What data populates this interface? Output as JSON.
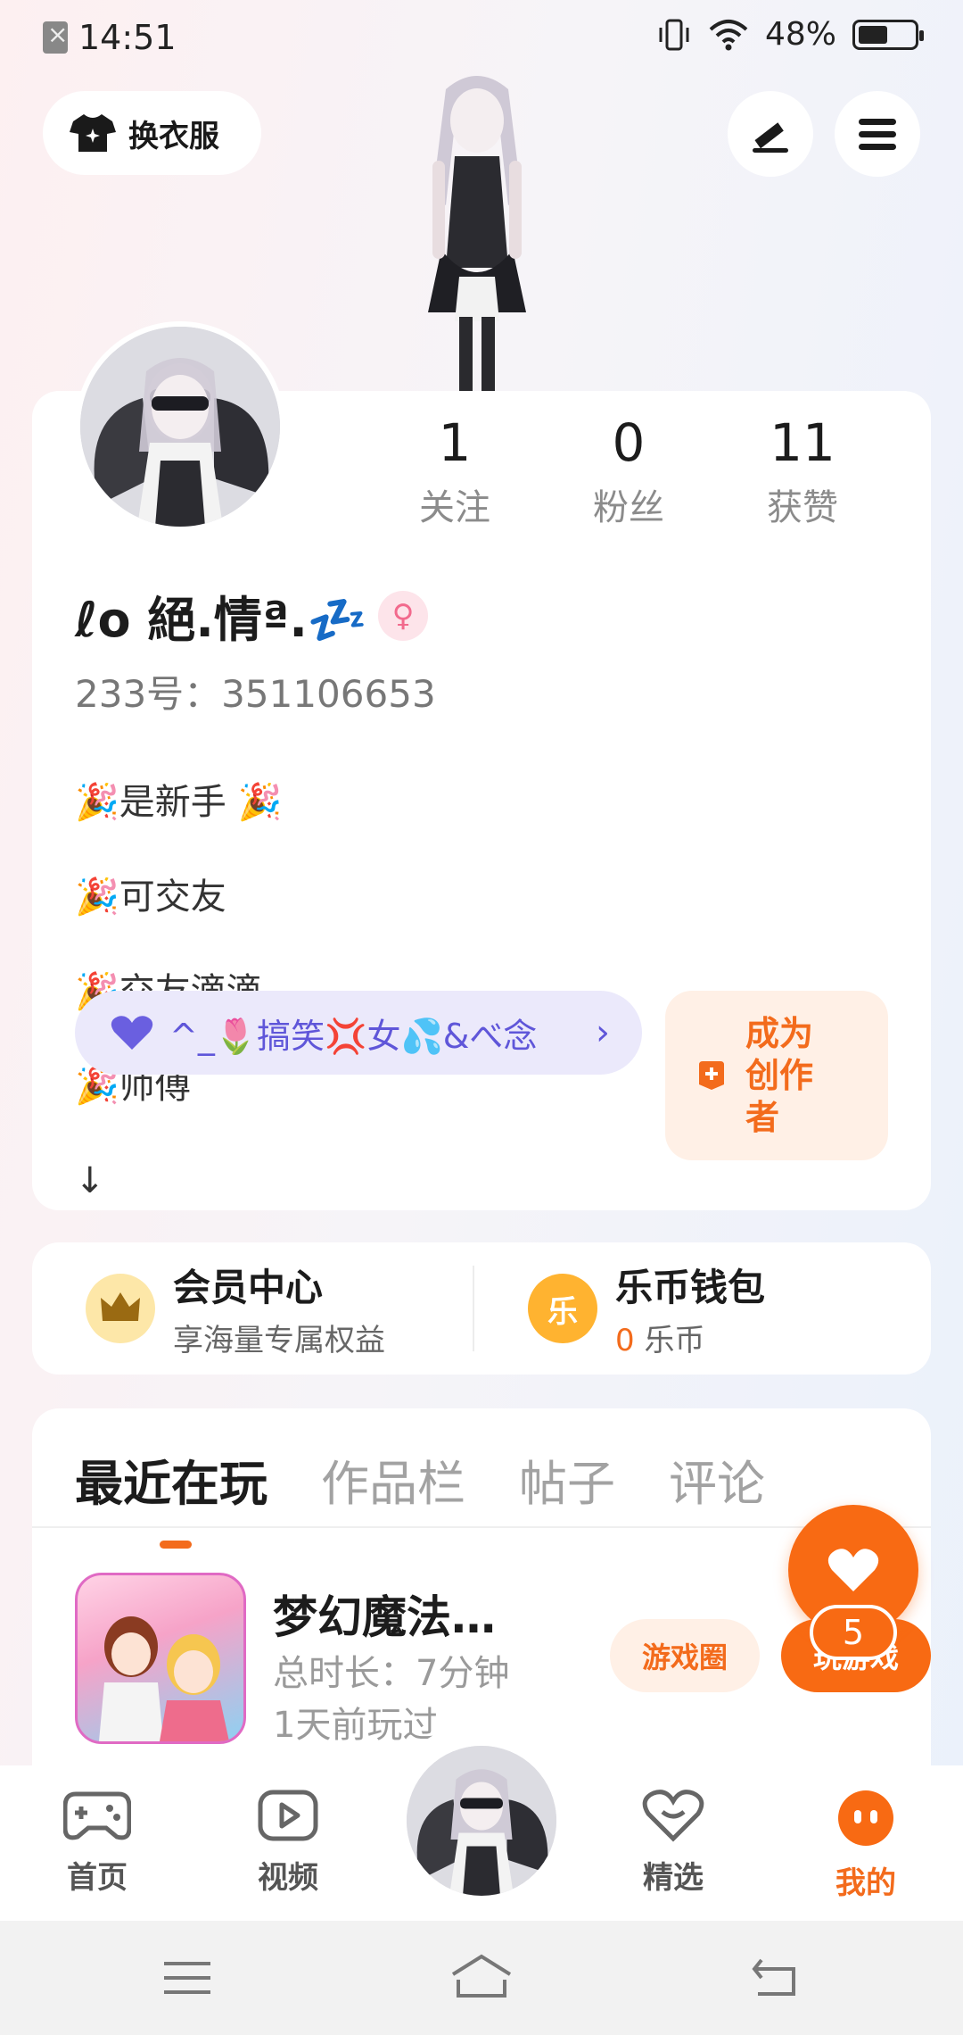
{
  "status_bar": {
    "time": "14:51",
    "battery": "48%"
  },
  "header": {
    "outfit_label": "换衣服"
  },
  "profile": {
    "stats": [
      {
        "value": "1",
        "label": "关注"
      },
      {
        "value": "0",
        "label": "粉丝"
      },
      {
        "value": "11",
        "label": "获赞"
      }
    ],
    "nickname": "ℓο 絕.情ª.💤",
    "gender_symbol": "♀",
    "id_line": "233号：351106653",
    "bio_lines": [
      "🎉是新手 🎉",
      "🎉可交友",
      "🎉交友滴滴",
      "🎉师傅",
      "↓"
    ],
    "tag_label": "^_🌷搞笑💢女💦&べ念",
    "tag_chevron": "›",
    "creator_label": "成为\n创作\n者"
  },
  "wallet": {
    "vip": {
      "title": "会员中心",
      "subtitle": "享海量专属权益",
      "icon_char": "♛"
    },
    "coins": {
      "title": "乐币钱包",
      "amount": "0",
      "unit": " 乐币",
      "icon_char": "乐"
    }
  },
  "tabs": [
    "最近在玩",
    "作品栏",
    "帖子",
    "评论"
  ],
  "recent_game": {
    "title": "梦幻魔法…",
    "duration": "总时长：7分钟",
    "last_played": "1天前玩过",
    "circle_button": "游戏圈",
    "play_button": "玩游戏"
  },
  "fab": {
    "badge": "5"
  },
  "bottom_nav": [
    {
      "label": "首页",
      "active": false
    },
    {
      "label": "视频",
      "active": false
    },
    {
      "label": "精选",
      "active": false
    },
    {
      "label": "我的",
      "active": true
    }
  ],
  "colors": {
    "accent": "#f36b1c",
    "tag_text": "#5f56d9",
    "tag_bg": "#ebe9fb"
  }
}
